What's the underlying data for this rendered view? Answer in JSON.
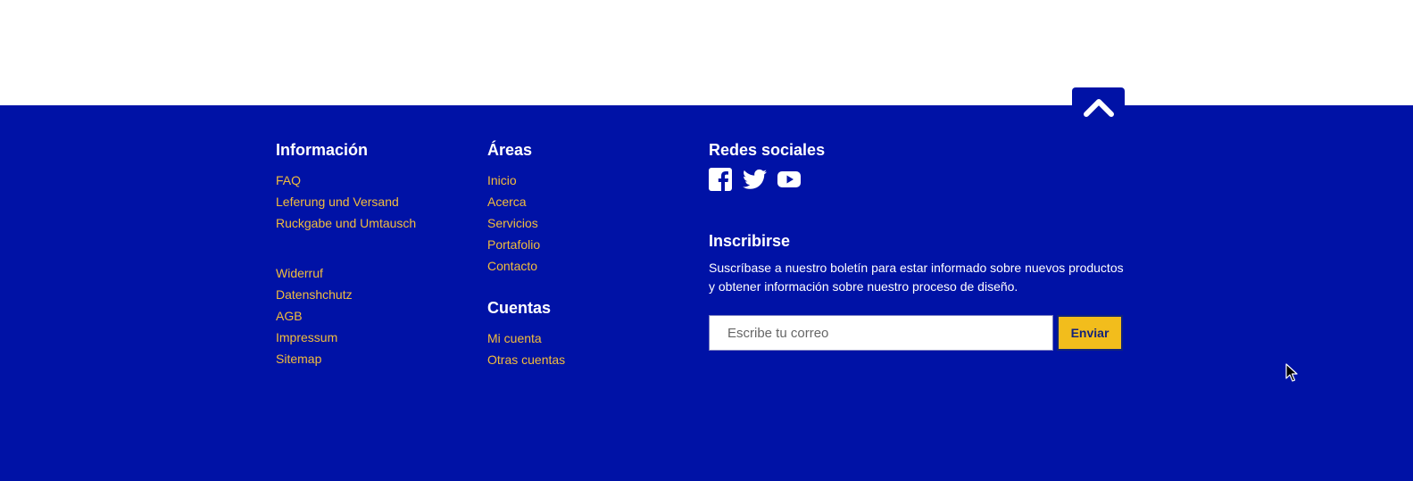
{
  "colors": {
    "footer_bg": "#0012a6",
    "link": "#f2bd3c",
    "heading": "#ffffff",
    "button_bg": "#f2bd1c",
    "button_text": "#13237a"
  },
  "back_to_top": {
    "icon": "chevron-up-icon"
  },
  "info": {
    "title": "Información",
    "links_group1": [
      "FAQ",
      "Leferung und Versand",
      "Ruckgabe und Umtausch"
    ],
    "links_group2": [
      "Widerruf",
      "Datenshchutz",
      "AGB",
      "Impressum",
      "Sitemap"
    ]
  },
  "areas": {
    "title": "Áreas",
    "links": [
      "Inicio",
      "Acerca",
      "Servicios",
      "Portafolio",
      "Contacto"
    ]
  },
  "accounts": {
    "title": "Cuentas",
    "links": [
      "Mi cuenta",
      "Otras cuentas"
    ]
  },
  "social": {
    "title": "Redes sociales",
    "icons": [
      "facebook-icon",
      "twitter-icon",
      "youtube-icon"
    ]
  },
  "subscribe": {
    "title": "Inscribirse",
    "text": "Suscríbase a nuestro boletín para estar informado sobre nuevos productos y obtener información sobre nuestro proceso de diseño.",
    "placeholder": "Escribe tu correo",
    "button_label": "Enviar"
  }
}
